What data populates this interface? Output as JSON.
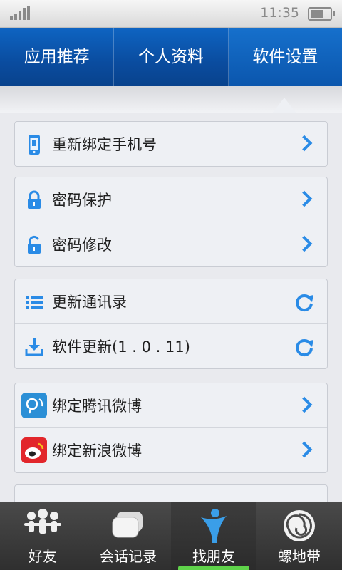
{
  "status": {
    "time": "11:35"
  },
  "tabs": [
    {
      "label": "应用推荐"
    },
    {
      "label": "个人资料"
    },
    {
      "label": "软件设置"
    }
  ],
  "groups": [
    {
      "items": [
        {
          "label": "重新绑定手机号",
          "icon": "phone-icon",
          "action": "chevron"
        }
      ]
    },
    {
      "items": [
        {
          "label": "密码保护",
          "icon": "lock-icon",
          "action": "chevron"
        },
        {
          "label": "密码修改",
          "icon": "unlock-icon",
          "action": "chevron"
        }
      ]
    },
    {
      "items": [
        {
          "label": "更新通讯录",
          "icon": "list-icon",
          "action": "refresh"
        },
        {
          "label": "软件更新(1 . 0 . 11)",
          "icon": "download-icon",
          "action": "refresh"
        }
      ]
    },
    {
      "items": [
        {
          "label": "绑定腾讯微博",
          "icon": "tencent-weibo-icon",
          "action": "chevron"
        },
        {
          "label": "绑定新浪微博",
          "icon": "sina-weibo-icon",
          "action": "chevron"
        }
      ]
    }
  ],
  "bottom_nav": [
    {
      "label": "好友",
      "icon": "friends-icon"
    },
    {
      "label": "会话记录",
      "icon": "chat-icon"
    },
    {
      "label": "找朋友",
      "icon": "find-friend-icon",
      "active": true
    },
    {
      "label": "螺地带",
      "icon": "spiral-icon"
    }
  ],
  "colors": {
    "tab_blue": "#0a4c9f",
    "accent_blue": "#2a8be6",
    "active_green": "#5fd34a"
  }
}
